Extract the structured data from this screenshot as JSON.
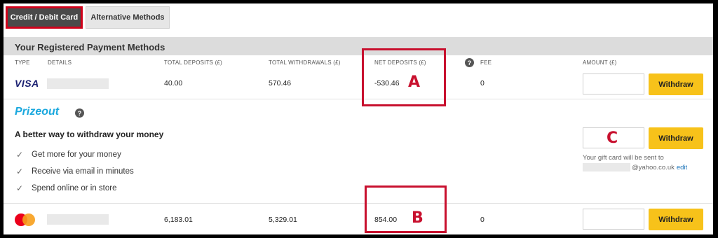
{
  "tabs": [
    {
      "label": "Credit / Debit Card",
      "active": true
    },
    {
      "label": "Alternative Methods",
      "active": false
    }
  ],
  "section_title": "Your Registered Payment Methods",
  "columns": {
    "type": "TYPE",
    "details": "DETAILS",
    "total_deposits": "TOTAL DEPOSITS (£)",
    "total_withdrawals": "TOTAL WITHDRAWALS (£)",
    "net_deposits": "NET DEPOSITS (£)",
    "fee": "FEE",
    "amount": "AMOUNT (£)"
  },
  "help_icon_glyph": "?",
  "rows": [
    {
      "card_brand": "VISA",
      "total_deposits": "40.00",
      "total_withdrawals": "570.46",
      "net_deposits": "-530.46",
      "fee": "0",
      "button": "Withdraw"
    },
    {
      "card_brand": "mastercard",
      "total_deposits": "6,183.01",
      "total_withdrawals": "5,329.01",
      "net_deposits": "854.00",
      "fee": "0",
      "button": "Withdraw"
    }
  ],
  "prizeout": {
    "logo_text": "Prizeout",
    "title": "A better way to withdraw your money",
    "benefits": [
      "Get more for your money",
      "Receive via email in minutes",
      "Spend online or in store"
    ],
    "button": "Withdraw",
    "gift_note": "Your gift card will be sent to",
    "email_suffix": "@yahoo.co.uk",
    "edit_link": "edit"
  },
  "annotations": {
    "a": "A",
    "b": "B",
    "c": "C",
    "color": "#c8102e"
  },
  "colors": {
    "withdraw_button": "#f7c21a",
    "active_tab": "#4a4a4a",
    "prizeout_brand": "#1aa8de",
    "visa": "#1a1f71"
  }
}
